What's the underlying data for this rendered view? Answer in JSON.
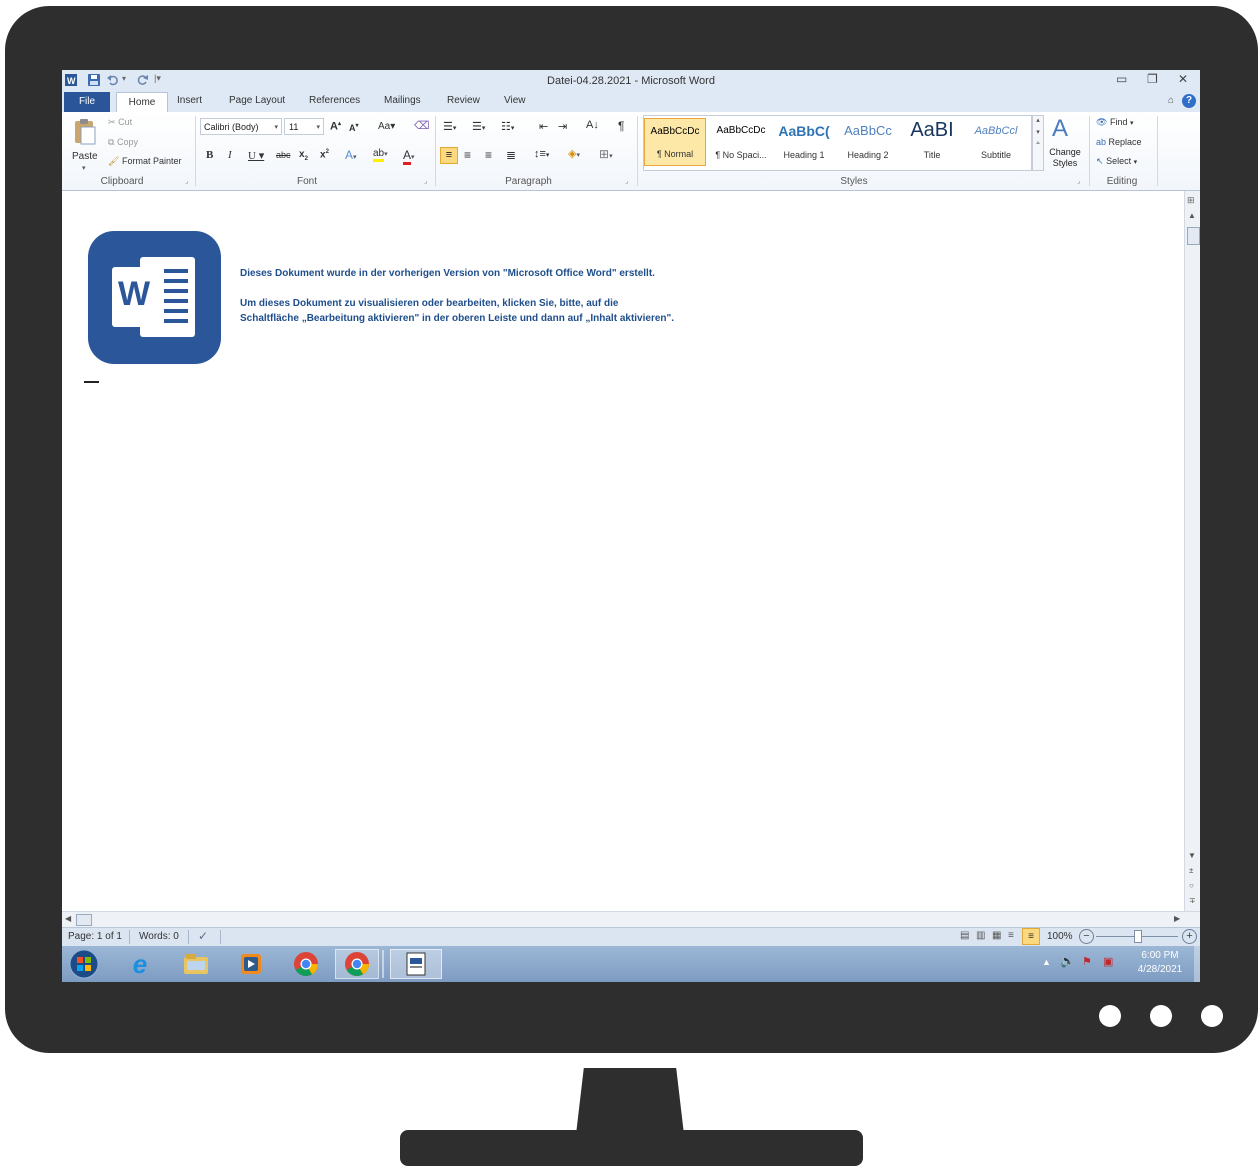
{
  "window": {
    "title": "Datei-04.28.2021  -  Microsoft Word"
  },
  "tabs": [
    {
      "label": "File"
    },
    {
      "label": "Home"
    },
    {
      "label": "Insert"
    },
    {
      "label": "Page Layout"
    },
    {
      "label": "References"
    },
    {
      "label": "Mailings"
    },
    {
      "label": "Review"
    },
    {
      "label": "View"
    }
  ],
  "clipboard": {
    "paste": "Paste",
    "cut": "Cut",
    "copy": "Copy",
    "format_painter": "Format Painter",
    "label": "Clipboard"
  },
  "font": {
    "name": "Calibri (Body)",
    "size": "11",
    "label": "Font"
  },
  "paragraph": {
    "label": "Paragraph"
  },
  "styles": {
    "items": [
      {
        "preview": "AaBbCcDc",
        "name": "¶ Normal"
      },
      {
        "preview": "AaBbCcDc",
        "name": "¶ No Spaci..."
      },
      {
        "preview": "AaBbC(",
        "name": "Heading 1"
      },
      {
        "preview": "AaBbCc",
        "name": "Heading 2"
      },
      {
        "preview": "AaBI",
        "name": "Title"
      },
      {
        "preview": "AaBbCcl",
        "name": "Subtitle"
      }
    ],
    "change_styles": "Change Styles",
    "label": "Styles"
  },
  "editing": {
    "find": "Find",
    "replace": "Replace",
    "select": "Select",
    "label": "Editing"
  },
  "document": {
    "line1": "Dieses Dokument wurde in der vorherigen Version von \"Microsoft Office Word\" erstellt.",
    "line2": "Um dieses Dokument zu visualisieren oder bearbeiten, klicken Sie, bitte, auf die",
    "line3": "Schaltfläche „Bearbeitung aktivieren\" in der oberen Leiste und dann auf „Inhalt aktivieren\".",
    "logo_letter": "W"
  },
  "status": {
    "page": "Page: 1 of 1",
    "words": "Words: 0",
    "zoom": "100%"
  },
  "taskbar": {
    "time": "6:00 PM",
    "date": "4/28/2021"
  },
  "colors": {
    "accent": "#2b579a",
    "doc_text": "#1f4e8c",
    "file_tab": "#2a5699"
  }
}
